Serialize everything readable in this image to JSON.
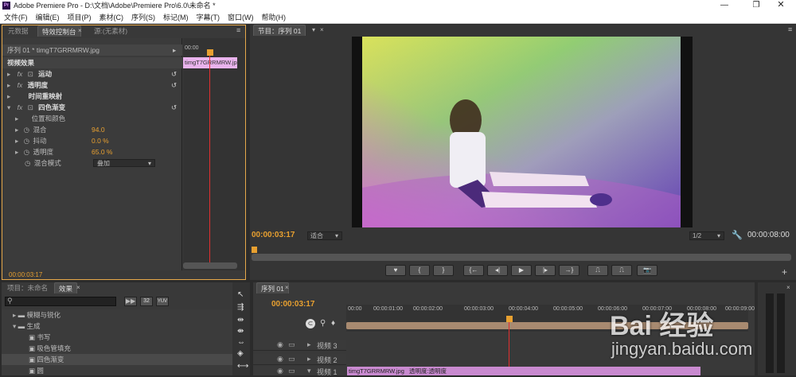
{
  "window": {
    "title": "Adobe Premiere Pro - D:\\文档\\Adobe\\Premiere Pro\\6.0\\未命名 *",
    "app_icon": "Pr",
    "controls": [
      "minimize",
      "maximize",
      "close"
    ]
  },
  "menu": [
    "文件(F)",
    "编辑(E)",
    "项目(P)",
    "素材(C)",
    "序列(S)",
    "标记(M)",
    "字幕(T)",
    "窗口(W)",
    "帮助(H)"
  ],
  "effect_panel": {
    "tabs": [
      "元数据",
      "特效控制台",
      "源:(无素材)"
    ],
    "clip_title": "序列 01 * timgT7GRRMRW.jpg",
    "timecode_head": "00:00",
    "clip_label": "timgT7GRRMRW.jpg",
    "section_label": "视频效果",
    "effects": [
      {
        "name": "运动",
        "has_fx": true,
        "has_reset": true
      },
      {
        "name": "透明度",
        "has_fx": true,
        "has_reset": true
      },
      {
        "name": "时间重映射",
        "has_fx": false,
        "has_reset": false
      },
      {
        "name": "四色渐变",
        "has_fx": true,
        "has_reset": true
      }
    ],
    "params": [
      {
        "name": "位置和颜色",
        "value": ""
      },
      {
        "name": "混合",
        "value": "94.0"
      },
      {
        "name": "抖动",
        "value": "0.0 %"
      },
      {
        "name": "透明度",
        "value": "65.0 %"
      }
    ],
    "blend_mode": {
      "label": "混合模式",
      "value": "叠加"
    },
    "timecode": "00:00:03:17"
  },
  "program_monitor": {
    "tab": "节目：序列 01",
    "timecode_current": "00:00:03:17",
    "fit": "适合",
    "resolution": "1/2",
    "timecode_duration": "00:00:08:00",
    "transport": [
      "marker",
      "in",
      "out",
      "go-in",
      "step-back",
      "play",
      "step-forward",
      "go-out",
      "lift",
      "extract",
      "export-frame"
    ]
  },
  "project_panel": {
    "tabs": [
      "项目：未命名",
      "效果"
    ],
    "search_placeholder": "",
    "filter_badges": [
      "32",
      "YUV"
    ],
    "tree": [
      {
        "label": "模糊与锐化",
        "level": 1,
        "type": "folder",
        "expanded": false
      },
      {
        "label": "生成",
        "level": 1,
        "type": "folder",
        "expanded": true
      },
      {
        "label": "书写",
        "level": 2,
        "type": "effect"
      },
      {
        "label": "吸色管填充",
        "level": 2,
        "type": "effect"
      },
      {
        "label": "四色渐变",
        "level": 2,
        "type": "effect",
        "selected": true
      },
      {
        "label": "圆",
        "level": 2,
        "type": "effect"
      }
    ]
  },
  "timeline": {
    "tab": "序列 01",
    "timecode": "00:00:03:17",
    "ruler": [
      "00:00",
      "00:00:01:00",
      "00:00:02:00",
      "00:00:03:00",
      "00:00:04:00",
      "00:00:05:00",
      "00:00:06:00",
      "00:00:07:00",
      "00:00:08:00",
      "00:00:09:00"
    ],
    "tracks": [
      {
        "name": "视频 3"
      },
      {
        "name": "视频 2"
      },
      {
        "name": "视频 1",
        "clip": "timgT7GRRMRW.jpg",
        "clip_fx": "透明度:透明度"
      }
    ]
  },
  "watermark": {
    "brand": "Bai 经验",
    "url": "jingyan.baidu.com"
  },
  "colors": {
    "accent": "#e8a030",
    "playhead": "#e03030",
    "clip": "#c98ad0",
    "panel": "#393939",
    "bg": "#2b2b2b"
  }
}
